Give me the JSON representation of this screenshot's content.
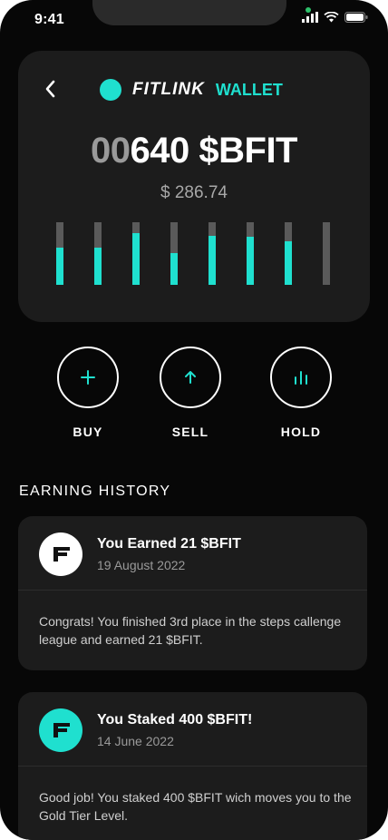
{
  "status": {
    "time": "9:41"
  },
  "header": {
    "brand": "FITLINK",
    "section": "WALLET"
  },
  "balance": {
    "leading_zeros": "00",
    "amount": "640",
    "unit": "$BFIT",
    "usd": "$ 286.74"
  },
  "bars": [
    0.6,
    0.6,
    0.82,
    0.5,
    0.78,
    0.77,
    0.7,
    0.0
  ],
  "actions": [
    {
      "label": "BUY",
      "icon": "plus-icon"
    },
    {
      "label": "SELL",
      "icon": "arrow-up-icon"
    },
    {
      "label": "HOLD",
      "icon": "bar-chart-icon"
    }
  ],
  "history": {
    "title": "EARNING HISTORY",
    "items": [
      {
        "title": "You Earned 21 $BFIT",
        "date": "19 August 2022",
        "body": "Congrats! You finished 3rd place in the steps callenge league and earned 21 $BFIT.",
        "avatar": "fitlink-logo-white"
      },
      {
        "title": "You Staked 400 $BFIT!",
        "date": "14 June 2022",
        "body": "Good job! You staked 400 $BFIT wich moves you to the Gold Tier Level.",
        "avatar": "fitlink-logo-teal"
      }
    ]
  },
  "colors": {
    "accent": "#1fe0cf",
    "background": "#070707",
    "card": "#1c1c1c"
  }
}
